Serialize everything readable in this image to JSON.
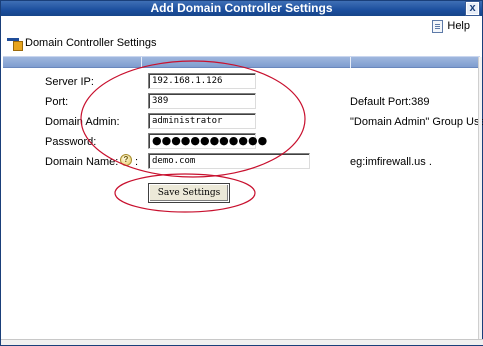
{
  "window": {
    "title": "Add Domain Controller Settings",
    "close_glyph": "x"
  },
  "help": {
    "label": "Help",
    "icon": "help-document-icon"
  },
  "section": {
    "title": "Domain Controller Settings",
    "icon": "domain-controller-icon"
  },
  "form": {
    "server_ip": {
      "label": "Server IP:",
      "value": "192.168.1.126"
    },
    "port": {
      "label": "Port:",
      "value": "389",
      "hint": "Default Port:389"
    },
    "domain_admin": {
      "label": "Domain Admin:",
      "value": "administrator",
      "hint": "\"Domain Admin\" Group User"
    },
    "password": {
      "label": "Password:",
      "masked_value": "●●●●●●●●●●●●"
    },
    "domain_name": {
      "label": "Domain Name:",
      "help_glyph": "?",
      "colon": ":",
      "value": "demo.com",
      "hint": "eg:imfirewall.us ."
    }
  },
  "save_button": {
    "label": "Save Settings"
  },
  "colors": {
    "titlebar": "#1c4f9e",
    "band": "#8aa6d5",
    "annotation_ellipse": "#c8102e"
  }
}
